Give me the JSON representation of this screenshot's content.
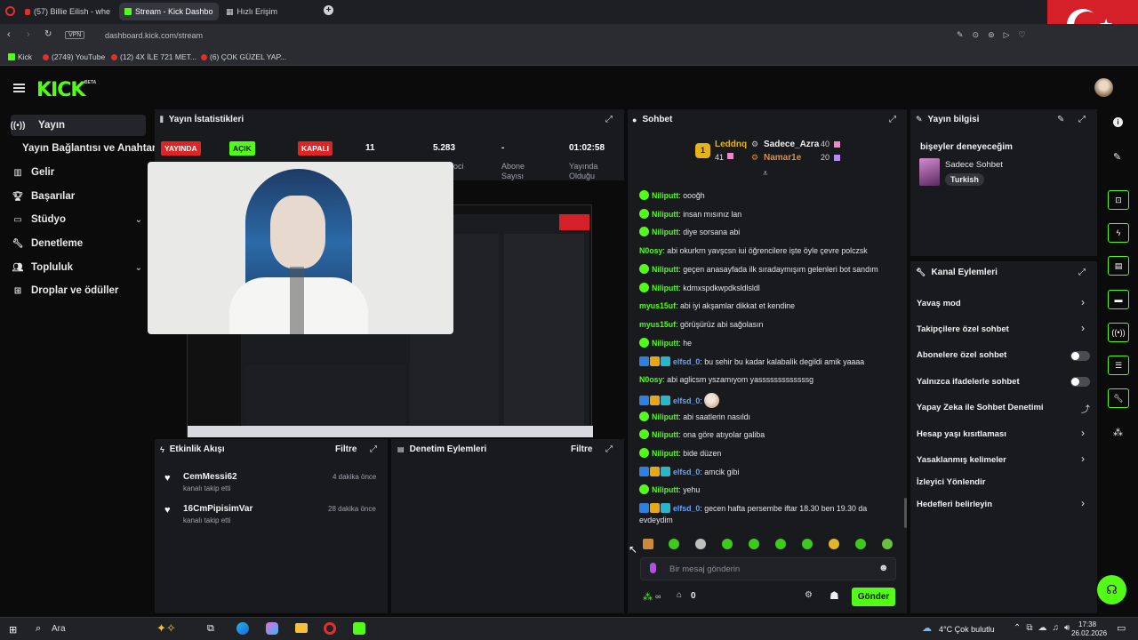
{
  "browser": {
    "tabs": [
      {
        "label": "(57) Billie Eilish - whe"
      },
      {
        "label": "Stream - Kick Dashbo"
      },
      {
        "label": "Hızlı Erişim"
      }
    ],
    "url": "dashboard.kick.com/stream",
    "vpn": "VPN",
    "bookmarks": [
      "Kick",
      "(2749) YouTube",
      "(12) 4X İLE 721 MET...",
      "(6) ÇOK GÜZEL YAP..."
    ]
  },
  "header": {
    "logo": "KICK",
    "beta": "BETA"
  },
  "sidebar": {
    "items": [
      {
        "label": "Yayın",
        "icon": "broadcast-icon"
      },
      {
        "label": "Yayın Bağlantısı ve Anahtarı",
        "icon": ""
      },
      {
        "label": "Gelir",
        "icon": "chart-icon"
      },
      {
        "label": "Başarılar",
        "icon": "trophy-icon"
      },
      {
        "label": "Stüdyo",
        "icon": "studio-icon"
      },
      {
        "label": "Denetleme",
        "icon": "wrench-icon"
      },
      {
        "label": "Topluluk",
        "icon": "community-icon"
      },
      {
        "label": "Droplar ve ödüller",
        "icon": "gift-icon"
      }
    ]
  },
  "stats": {
    "title": "Yayın İstatistikleri",
    "live_badge": "YAYINDA",
    "on_badge": "AÇIK",
    "off_badge": "KAPALI",
    "viewers": "11",
    "followers": "5.283",
    "followers_label": "oci",
    "subs": "-",
    "subs_label": "Abone Sayısı",
    "duration": "01:02:58",
    "duration_label": "Yayında Olduğu"
  },
  "activity": {
    "title": "Etkinlik Akışı",
    "filter": "Filtre",
    "events": [
      {
        "user": "CemMessi62",
        "action": "kanalı takip etti",
        "time": "4 dakika önce"
      },
      {
        "user": "16CmPipisimVar",
        "action": "kanalı takip etti",
        "time": "28 dakika önce"
      }
    ]
  },
  "moderation": {
    "title": "Denetim Eylemleri",
    "filter": "Filtre"
  },
  "chat": {
    "title": "Sohbet",
    "leaders": [
      {
        "rank": "1",
        "name": "Leddnq",
        "score": "41"
      },
      {
        "name": "Sadece_Azra",
        "score": "40"
      },
      {
        "name": "Namar1e",
        "score": "20"
      }
    ],
    "messages": [
      {
        "user": "Niliputt",
        "text": "oooğh",
        "style": "green"
      },
      {
        "user": "Niliputt",
        "text": "insan mısınız lan",
        "style": "green"
      },
      {
        "user": "Niliputt",
        "text": "diye sorsana abi",
        "style": "green"
      },
      {
        "user": "N0osy",
        "text": "abi okurkrn yavşcsn iui öğrencilere işte öyle çevre polczsk",
        "style": "plain"
      },
      {
        "user": "Niliputt",
        "text": "geçen anasayfada ilk sıradaymışım gelenleri bot sandım",
        "style": "green"
      },
      {
        "user": "Niliputt",
        "text": "kdmxspdkwpdksldlsldl",
        "style": "green"
      },
      {
        "user": "myus15uf",
        "text": "abi iyi akşamlar dikkat et kendine",
        "style": "plain"
      },
      {
        "user": "myus15uf",
        "text": "görüşürüz abi sağolasın",
        "style": "plain"
      },
      {
        "user": "Niliputt",
        "text": "he",
        "style": "green"
      },
      {
        "user": "elfsd_0",
        "text": "bu sehir bu kadar kalabalik degildi amik yaaaa",
        "style": "mod"
      },
      {
        "user": "N0osy",
        "text": "abi aglicsm yszamıyom yasssssssssssssg",
        "style": "plain"
      },
      {
        "user": "elfsd_0",
        "text": "",
        "style": "mod"
      },
      {
        "user": "Niliputt",
        "text": "abi saatlerin nasıldı",
        "style": "green"
      },
      {
        "user": "Niliputt",
        "text": "ona göre atıyolar galiba",
        "style": "green"
      },
      {
        "user": "Niliputt",
        "text": "bide düzen",
        "style": "green"
      },
      {
        "user": "elfsd_0",
        "text": "amcik gibi",
        "style": "mod"
      },
      {
        "user": "Niliputt",
        "text": "yehu",
        "style": "green"
      },
      {
        "user": "elfsd_0",
        "text": "gecen hafta persembe iftar 18.30 ben 19.30 da evdeydim",
        "style": "mod"
      }
    ],
    "placeholder": "Bir mesaj gönderin",
    "send": "Gönder",
    "points": "∞",
    "counter": "0"
  },
  "stream_info": {
    "title": "Yayın bilgisi",
    "stream_title": "bişeyler deneyeceğim",
    "category": "Sadece Sohbet",
    "tag": "Turkish"
  },
  "channel_actions": {
    "title": "Kanal Eylemleri",
    "items": [
      {
        "label": "Yavaş mod",
        "ctrl": "arrow"
      },
      {
        "label": "Takipçilere özel sohbet",
        "ctrl": "arrow"
      },
      {
        "label": "Abonelere özel sohbet",
        "ctrl": "toggle"
      },
      {
        "label": "Yalnızca ifadelerle sohbet",
        "ctrl": "toggle"
      },
      {
        "label": "Yapay Zeka ile Sohbet Denetimi",
        "ctrl": "link"
      },
      {
        "label": "Hesap yaşı kısıtlaması",
        "ctrl": "arrow"
      },
      {
        "label": "Yasaklanmış kelimeler",
        "ctrl": "arrow"
      },
      {
        "label": "İzleyici Yönlendir",
        "ctrl": "none"
      },
      {
        "label": "Hedefleri belirleyin",
        "ctrl": "arrow"
      }
    ]
  },
  "taskbar": {
    "search": "Ara",
    "weather": "4°C  Çok bulutlu",
    "time": "17:38",
    "date": "26.02.2026"
  },
  "colors": {
    "accent": "#53fc18",
    "live": "#e02424",
    "panel": "#181a1e"
  }
}
